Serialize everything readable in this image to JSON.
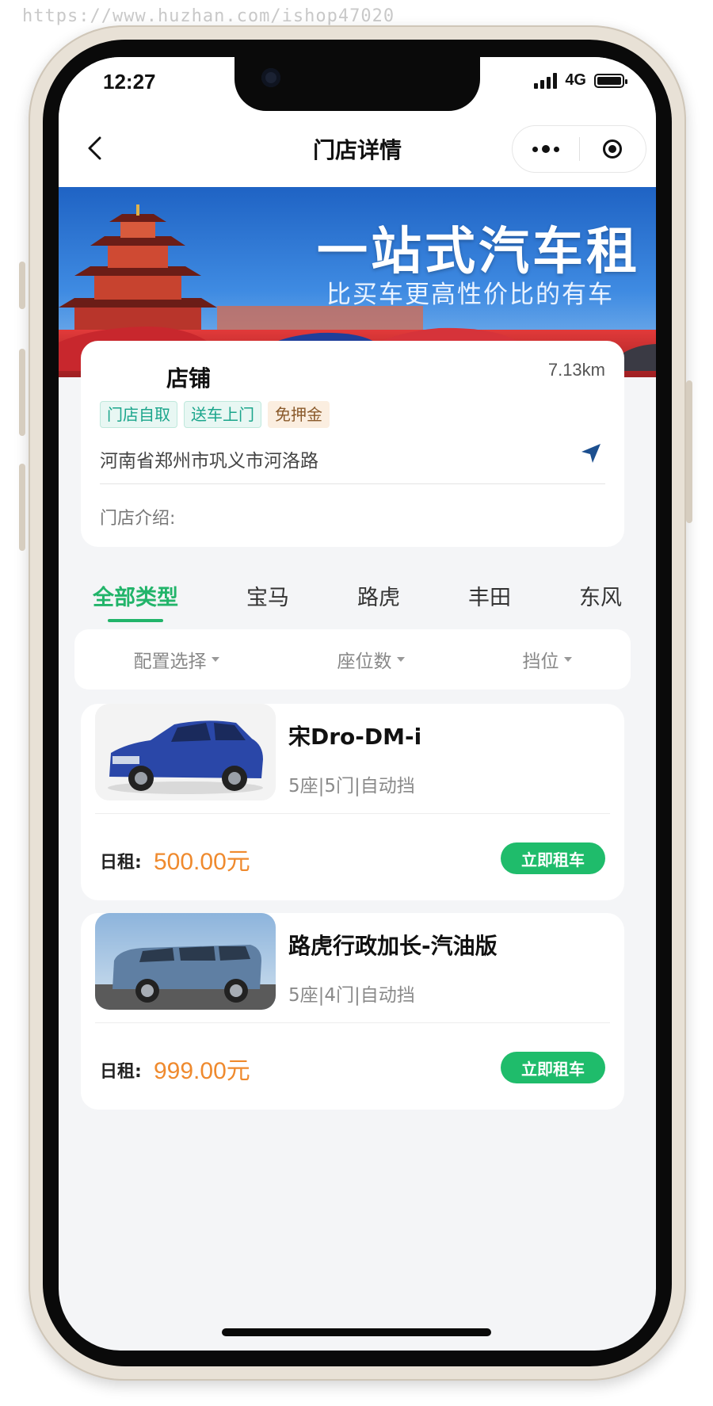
{
  "watermark": "https://www.huzhan.com/ishop47020",
  "status_bar": {
    "time": "12:27",
    "network": "4G"
  },
  "nav": {
    "title": "门店详情"
  },
  "banner": {
    "title": "一站式汽车租",
    "subtitle": "比买车更高性价比的有车"
  },
  "store": {
    "name": "店铺",
    "distance": "7.13km",
    "tags": [
      "门店自取",
      "送车上门",
      "免押金"
    ],
    "address": "河南省郑州市巩义市河洛路",
    "intro_label": "门店介绍:"
  },
  "tabs": [
    {
      "label": "全部类型",
      "active": true
    },
    {
      "label": "宝马",
      "active": false
    },
    {
      "label": "路虎",
      "active": false
    },
    {
      "label": "丰田",
      "active": false
    },
    {
      "label": "东风",
      "active": false
    }
  ],
  "filters": [
    "配置选择",
    "座位数",
    "挡位"
  ],
  "cars": [
    {
      "name": "宋Dro-DM-i",
      "specs": "5座|5门|自动挡",
      "price_label": "日租:",
      "price": "500.00元",
      "button": "立即租车",
      "color": "#2a47a8"
    },
    {
      "name": "路虎行政加长-汽油版",
      "specs": "5座|4门|自动挡",
      "price_label": "日租:",
      "price": "999.00元",
      "button": "立即租车",
      "color": "#5f7fa3"
    }
  ],
  "colors": {
    "accent_green": "#22b46a",
    "button_green": "#1fbc6b",
    "price_orange": "#ef8a2e"
  }
}
